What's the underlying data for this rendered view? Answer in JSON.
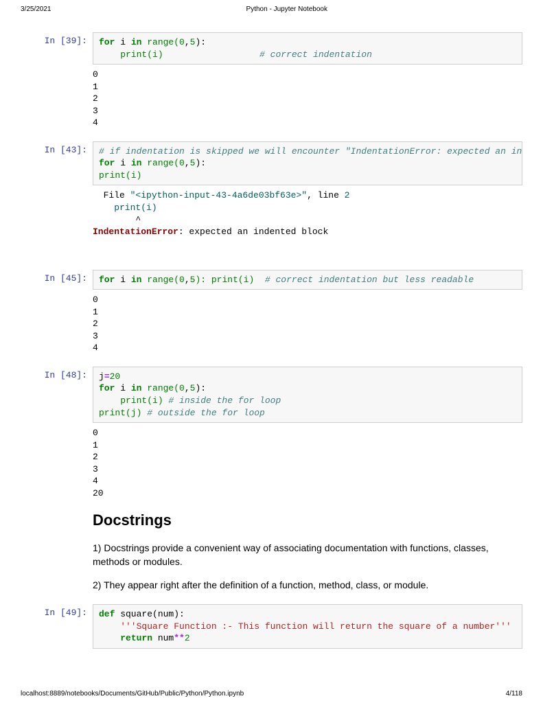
{
  "header": {
    "date": "3/25/2021",
    "title": "Python - Jupyter Notebook"
  },
  "cells": {
    "c39": {
      "prompt": "In [39]:",
      "line1_a": "for",
      "line1_b": " i ",
      "line1_c": "in",
      "line1_d": " range(",
      "line1_e": "0",
      "line1_f": ",",
      "line1_g": "5",
      "line1_h": "):",
      "line2_a": "    print(i)                  ",
      "line2_b": "# correct indentation",
      "output": "0\n1\n2\n3\n4"
    },
    "c43": {
      "prompt": "In [43]:",
      "line1": "# if indentation is skipped we will encounter \"IndentationError: expected an inde",
      "line2_a": "for",
      "line2_b": " i ",
      "line2_c": "in",
      "line2_d": " range(",
      "line2_e": "0",
      "line2_f": ",",
      "line2_g": "5",
      "line2_h": "):",
      "line3": "print(i)",
      "err1_a": "  File ",
      "err1_b": "\"<ipython-input-43-4a6de03bf63e>\"",
      "err1_c": ", line ",
      "err1_d": "2",
      "err2": "    print(i)",
      "err3": "        ^",
      "err4_a": "IndentationError",
      "err4_b": ": expected an indented block"
    },
    "c45": {
      "prompt": "In [45]:",
      "line1_a": "for",
      "line1_b": " i ",
      "line1_c": "in",
      "line1_d": " range(",
      "line1_e": "0",
      "line1_f": ",",
      "line1_g": "5",
      "line1_h": "): print(i)  ",
      "line1_i": "# correct indentation but less readable",
      "output": "0\n1\n2\n3\n4"
    },
    "c48": {
      "prompt": "In [48]:",
      "l1_a": "j",
      "l1_b": "=",
      "l1_c": "20",
      "l2_a": "for",
      "l2_b": " i ",
      "l2_c": "in",
      "l2_d": " range(",
      "l2_e": "0",
      "l2_f": ",",
      "l2_g": "5",
      "l2_h": "):",
      "l3_a": "    print(i) ",
      "l3_b": "# inside the for loop",
      "l4_a": "print(j) ",
      "l4_b": "# outside the for loop",
      "output": "0\n1\n2\n3\n4\n20"
    },
    "c49": {
      "prompt": "In [49]:",
      "l1_a": "def",
      "l1_b": " square(num):",
      "l2": "    '''Square Function :- This function will return the square of a number'''",
      "l3_a": "    ",
      "l3_b": "return",
      "l3_c": " num",
      "l3_d": "**",
      "l3_e": "2"
    }
  },
  "markdown": {
    "heading": "Docstrings",
    "p1": "1) Docstrings provide a convenient way of associating documentation with functions, classes, methods or modules.",
    "p2": "2) They appear right after the definition of a function, method, class, or module."
  },
  "footer": {
    "url": "localhost:8889/notebooks/Documents/GitHub/Public/Python/Python.ipynb",
    "page": "4/118"
  }
}
